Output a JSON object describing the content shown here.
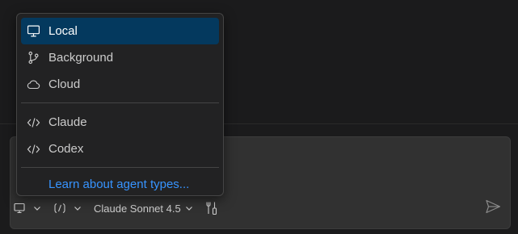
{
  "menu": {
    "items": [
      {
        "label": "Local",
        "icon": "monitor-icon",
        "selected": true
      },
      {
        "label": "Background",
        "icon": "source-branch-icon",
        "selected": false
      },
      {
        "label": "Cloud",
        "icon": "cloud-icon",
        "selected": false
      }
    ],
    "agents": [
      {
        "label": "Claude",
        "icon": "code-icon"
      },
      {
        "label": "Codex",
        "icon": "code-icon"
      }
    ],
    "link": "Learn about agent types..."
  },
  "toolbar": {
    "model_label": "Claude Sonnet 4.5",
    "icons": [
      "monitor-icon",
      "agent-icon",
      "tools-icon",
      "send-icon"
    ]
  },
  "colors": {
    "selected_bg": "#04395e",
    "link": "#3794ff",
    "menu_bg": "#222223",
    "panel_bg": "#313131"
  }
}
